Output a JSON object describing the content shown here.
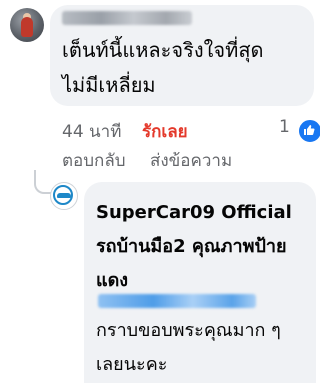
{
  "comment": {
    "text": "เต็นท์นี้แหละจริงใจที่สุด ไม่มีเหลี่ยม",
    "time": "44 นาที",
    "like_label": "รักเลย",
    "reply_label": "ตอบกลับ",
    "send_label": "ส่งข้อความ",
    "reaction_count": "1",
    "reaction_icon": "like-icon",
    "like_color": "#e4392b"
  },
  "reply": {
    "author": "SuperCar09 Official รถบ้านมือ2 คุณภาพป้ายแดง",
    "message": "กราบขอบพระคุณมาก ๆ เลยนะคะ"
  }
}
